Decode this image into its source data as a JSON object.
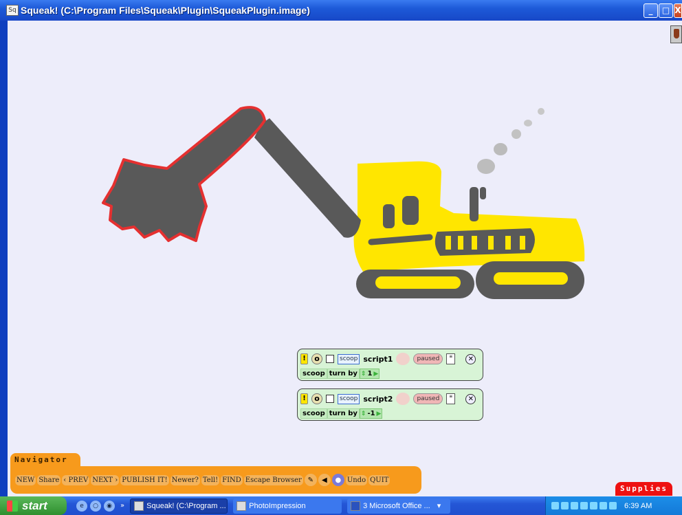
{
  "window": {
    "title": "Squeak! (C:\\Program Files\\Squeak\\Plugin\\SqueakPlugin.image)",
    "app_icon": "squeak-icon",
    "buttons": [
      "minimize",
      "maximize",
      "close"
    ]
  },
  "colors": {
    "titlebar": "#1d5ad8",
    "canvas": "#ededfa",
    "navigator": "#f79a1c",
    "supplies": "#ee1111",
    "script_bg": "#d8f4d6",
    "excavator_yellow": "#ffe600",
    "excavator_gray": "#595959",
    "bucket_outline": "#e53030"
  },
  "scripts": [
    {
      "player": "scoop",
      "name": "script1",
      "status": "paused",
      "command_subject": "scoop",
      "command": "turn by",
      "argument": "1"
    },
    {
      "player": "scoop",
      "name": "script2",
      "status": "paused",
      "command_subject": "scoop",
      "command": "turn by",
      "argument": "-1"
    }
  ],
  "navigator": {
    "tab_label": "Navigator",
    "buttons": [
      "NEW",
      "Share",
      "‹ PREV",
      "NEXT ›",
      "PUBLISH IT!",
      "Newer?",
      "Tell!",
      "FIND",
      "Escape Browser",
      "Undo",
      "QUIT"
    ]
  },
  "supplies": {
    "label": "Supplies"
  },
  "taskbar": {
    "start_label": "start",
    "tasks": [
      "Squeak! (C:\\Program ...",
      "PhotoImpression",
      "3 Microsoft Office ..."
    ],
    "clock": "6:39 AM"
  }
}
